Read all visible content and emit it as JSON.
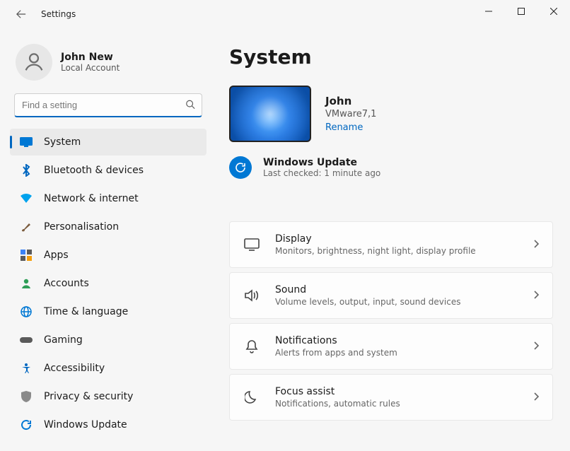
{
  "window": {
    "title": "Settings"
  },
  "profile": {
    "name": "John New",
    "sub": "Local Account"
  },
  "search": {
    "placeholder": "Find a setting"
  },
  "sidebar": {
    "items": [
      {
        "label": "System",
        "icon": "system",
        "color": "#0078d4",
        "selected": true
      },
      {
        "label": "Bluetooth & devices",
        "icon": "bluetooth",
        "color": "#0067c0"
      },
      {
        "label": "Network & internet",
        "icon": "wifi",
        "color": "#00a2ed"
      },
      {
        "label": "Personalisation",
        "icon": "brush",
        "color": "#7b5c3e"
      },
      {
        "label": "Apps",
        "icon": "apps",
        "color": "#5a5a5a"
      },
      {
        "label": "Accounts",
        "icon": "person",
        "color": "#2e9e57"
      },
      {
        "label": "Time & language",
        "icon": "globe",
        "color": "#0078d4"
      },
      {
        "label": "Gaming",
        "icon": "gamepad",
        "color": "#5a5a5a"
      },
      {
        "label": "Accessibility",
        "icon": "accessibility",
        "color": "#0067c0"
      },
      {
        "label": "Privacy & security",
        "icon": "shield",
        "color": "#8a8a8a"
      },
      {
        "label": "Windows Update",
        "icon": "update",
        "color": "#0078d4"
      }
    ]
  },
  "page": {
    "title": "System"
  },
  "device": {
    "name": "John",
    "model": "VMware7,1",
    "rename_label": "Rename"
  },
  "windows_update": {
    "title": "Windows Update",
    "last_checked": "Last checked: 1 minute ago"
  },
  "cards": [
    {
      "title": "Display",
      "desc": "Monitors, brightness, night light, display profile",
      "icon": "display"
    },
    {
      "title": "Sound",
      "desc": "Volume levels, output, input, sound devices",
      "icon": "sound"
    },
    {
      "title": "Notifications",
      "desc": "Alerts from apps and system",
      "icon": "bell"
    },
    {
      "title": "Focus assist",
      "desc": "Notifications, automatic rules",
      "icon": "moon"
    }
  ]
}
